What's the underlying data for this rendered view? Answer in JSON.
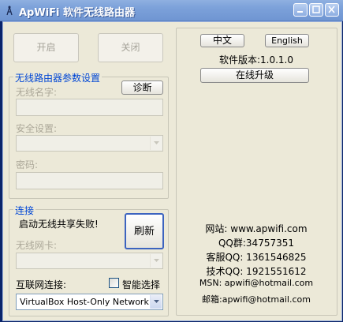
{
  "window": {
    "title": "ApWiFi 软件无线路由器"
  },
  "controls": {
    "start_label": "开启",
    "close_label": "关闭"
  },
  "router_settings": {
    "legend": "无线路由器参数设置",
    "diagnose_label": "诊断",
    "name_label": "无线名字:",
    "name_value": "",
    "security_label": "安全设置:",
    "security_value": "",
    "password_label": "密码:",
    "password_value": ""
  },
  "connection": {
    "legend": "连接",
    "status_text": "启动无线共享失败!",
    "refresh_label": "刷新",
    "nic_label": "无线网卡:",
    "nic_value": "",
    "internet_label": "互联网连接:",
    "smart_select_label": "智能选择",
    "smart_select_checked": false,
    "internet_value": "VirtualBox Host-Only Network"
  },
  "right_panel": {
    "lang_chinese": "中文",
    "lang_english": "English",
    "version_text": "软件版本:1.0.1.0",
    "upgrade_label": "在线升级",
    "info": [
      "网站: www.apwifi.com",
      "QQ群:34757351",
      "客服QQ: 1361546825",
      "技术QQ: 1921551612",
      "MSN: apwifi@hotmail.com",
      "邮箱:apwifi@hotmail.com"
    ]
  }
}
